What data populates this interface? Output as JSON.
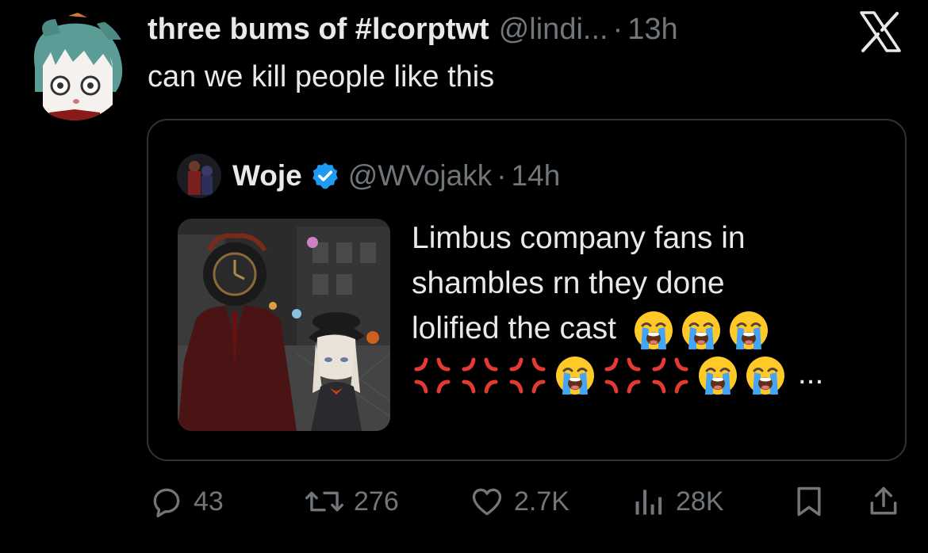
{
  "tweet": {
    "display_name": "three bums of #lcorptwt",
    "handle": "@lindi...",
    "separator": "·",
    "time": "13h",
    "text": "can we kill people like this",
    "avatar_icon": "avatar-anime-girl-icon"
  },
  "quote": {
    "display_name": "Woje",
    "handle": "@WVojakk",
    "separator": "·",
    "time": "14h",
    "verified": true,
    "text_line1": "Limbus company fans in",
    "text_line2": "shambles rn they done",
    "text_line3": "lolified the cast",
    "emoji_line3": [
      "loudly-crying-face",
      "loudly-crying-face",
      "loudly-crying-face"
    ],
    "emoji_line4": [
      "anger-symbol",
      "anger-symbol",
      "anger-symbol",
      "loudly-crying-face",
      "anger-symbol",
      "anger-symbol",
      "loudly-crying-face",
      "loudly-crying-face"
    ],
    "ellipsis": "..."
  },
  "actions": {
    "replies": "43",
    "reposts": "276",
    "likes": "2.7K",
    "views": "28K",
    "reply_icon": "reply-icon",
    "repost_icon": "repost-icon",
    "like_icon": "heart-icon",
    "views_icon": "views-icon",
    "bookmark_icon": "bookmark-icon",
    "share_icon": "share-icon"
  },
  "colors": {
    "background": "#000000",
    "text_primary": "#e7e9ea",
    "text_secondary": "#71767b",
    "border": "#2f3336",
    "verified_blue": "#1d9bf0"
  }
}
